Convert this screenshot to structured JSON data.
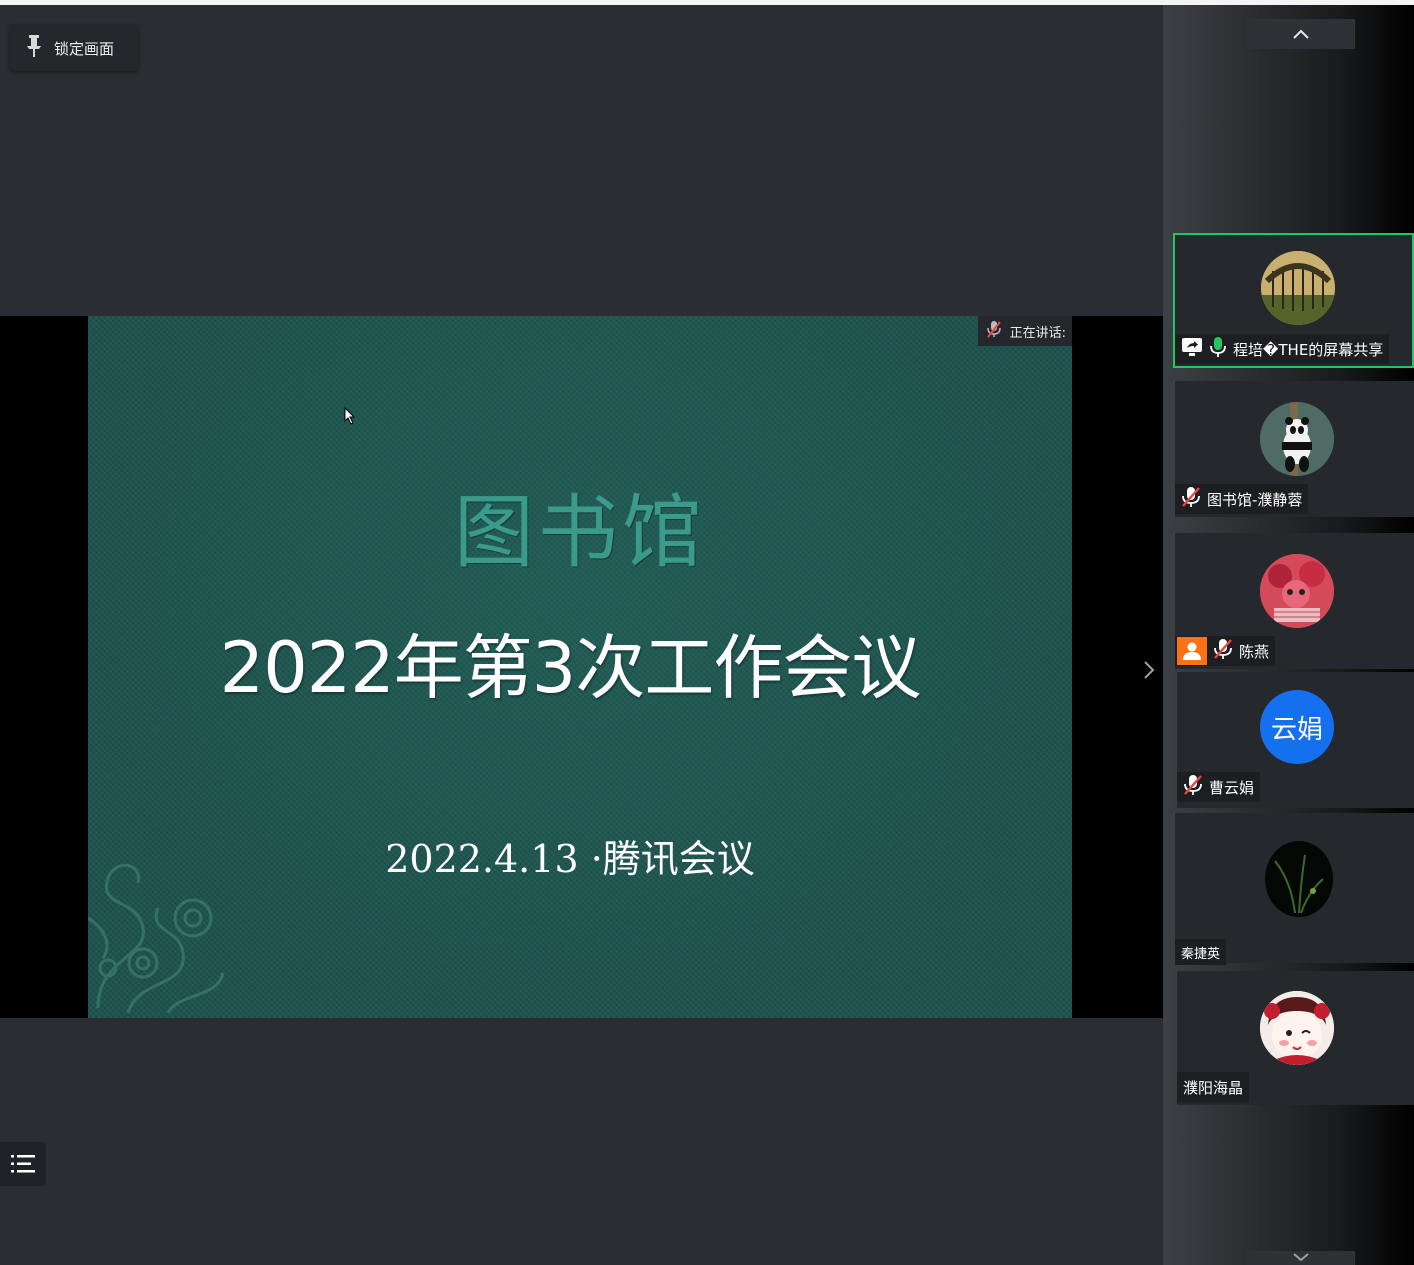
{
  "toolbar": {
    "lock_label": "锁定画面"
  },
  "share": {
    "speaking_label": "正在讲话:"
  },
  "slide": {
    "title1": "图书馆",
    "title2": "2022年第3次工作会议",
    "date": "2022.4.13 ·腾讯会议"
  },
  "participants": [
    {
      "name": "程培�THE的屏幕共享",
      "status": "sharing, mic-on"
    },
    {
      "name": "图书馆-濮静蓉",
      "status": "muted"
    },
    {
      "name": "陈燕",
      "status": "host, muted"
    },
    {
      "name": "曹云娟",
      "status": "muted",
      "avatar_text": "云娟"
    },
    {
      "name": "秦捷英",
      "status": ""
    },
    {
      "name": "濮阳海晶",
      "status": ""
    }
  ],
  "colors": {
    "active_border": "#22c55e",
    "avatar_blue": "#1570ef",
    "host_orange": "#f97316",
    "mic_green": "#22c55e"
  },
  "icons": [
    "pin-icon",
    "menu-list-icon",
    "chevron-up-icon",
    "chevron-down-icon",
    "chevron-right-icon",
    "mic-muted-icon",
    "mic-on-icon",
    "screen-share-icon",
    "host-icon",
    "mouse-cursor-icon"
  ]
}
